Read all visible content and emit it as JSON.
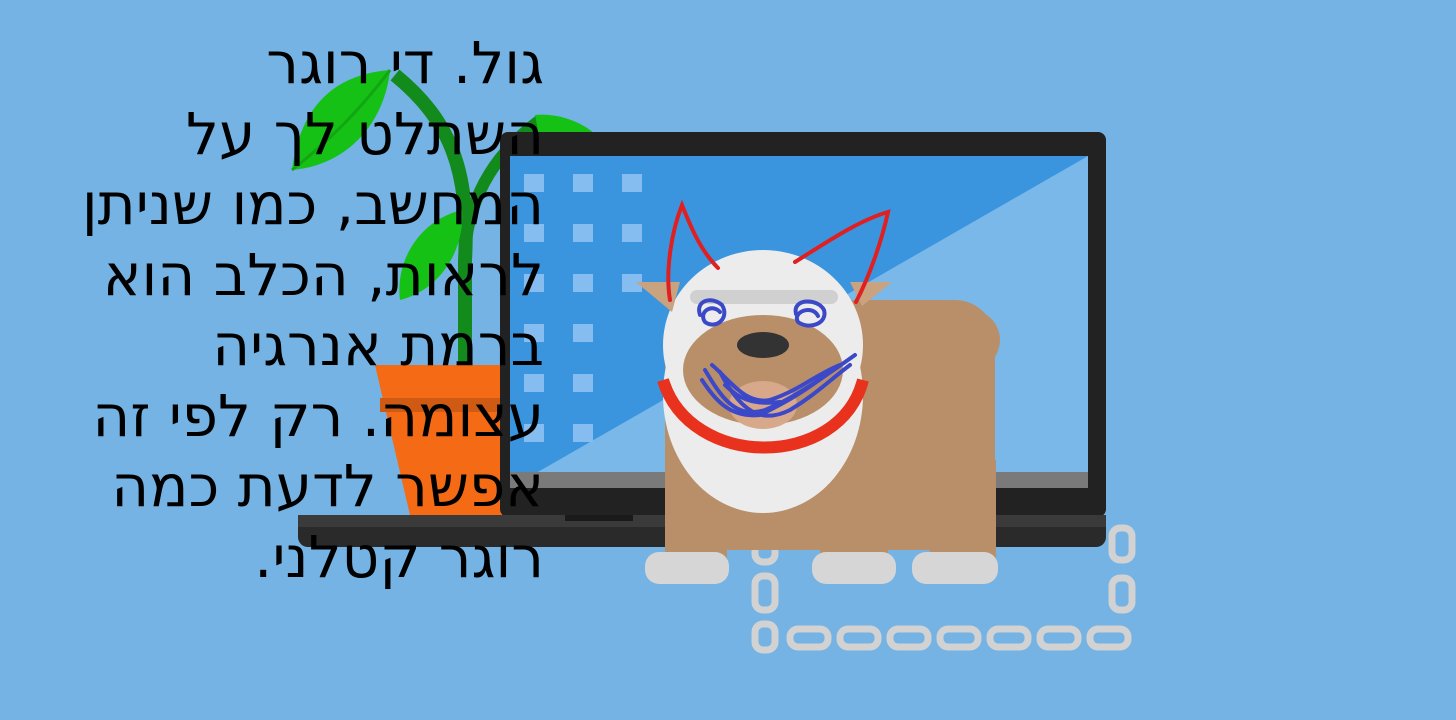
{
  "caption": {
    "lines": [
      "גול. די רוגר",
      "השתלט לך על",
      "המחשב, כמו שניתן",
      "לראות, הכלב הוא",
      "ברמת אנרגיה",
      "עצומה. רק לפי זה",
      "אפשר לדעת כמה",
      "רוגר קטלני."
    ]
  },
  "colors": {
    "background": "#74b3e3",
    "laptop_frame": "#222222",
    "screen_dark": "#3a95de",
    "screen_light": "#7ab8ea",
    "pot": "#f46a15",
    "leaf": "#16c116",
    "stem": "#138a1c",
    "dog_body": "#b98f69",
    "dog_white": "#eeeeee",
    "collar": "#e8321d",
    "chain": "#d2d2d2",
    "scribble_red": "#e02020",
    "scribble_blue": "#3b48c8"
  }
}
